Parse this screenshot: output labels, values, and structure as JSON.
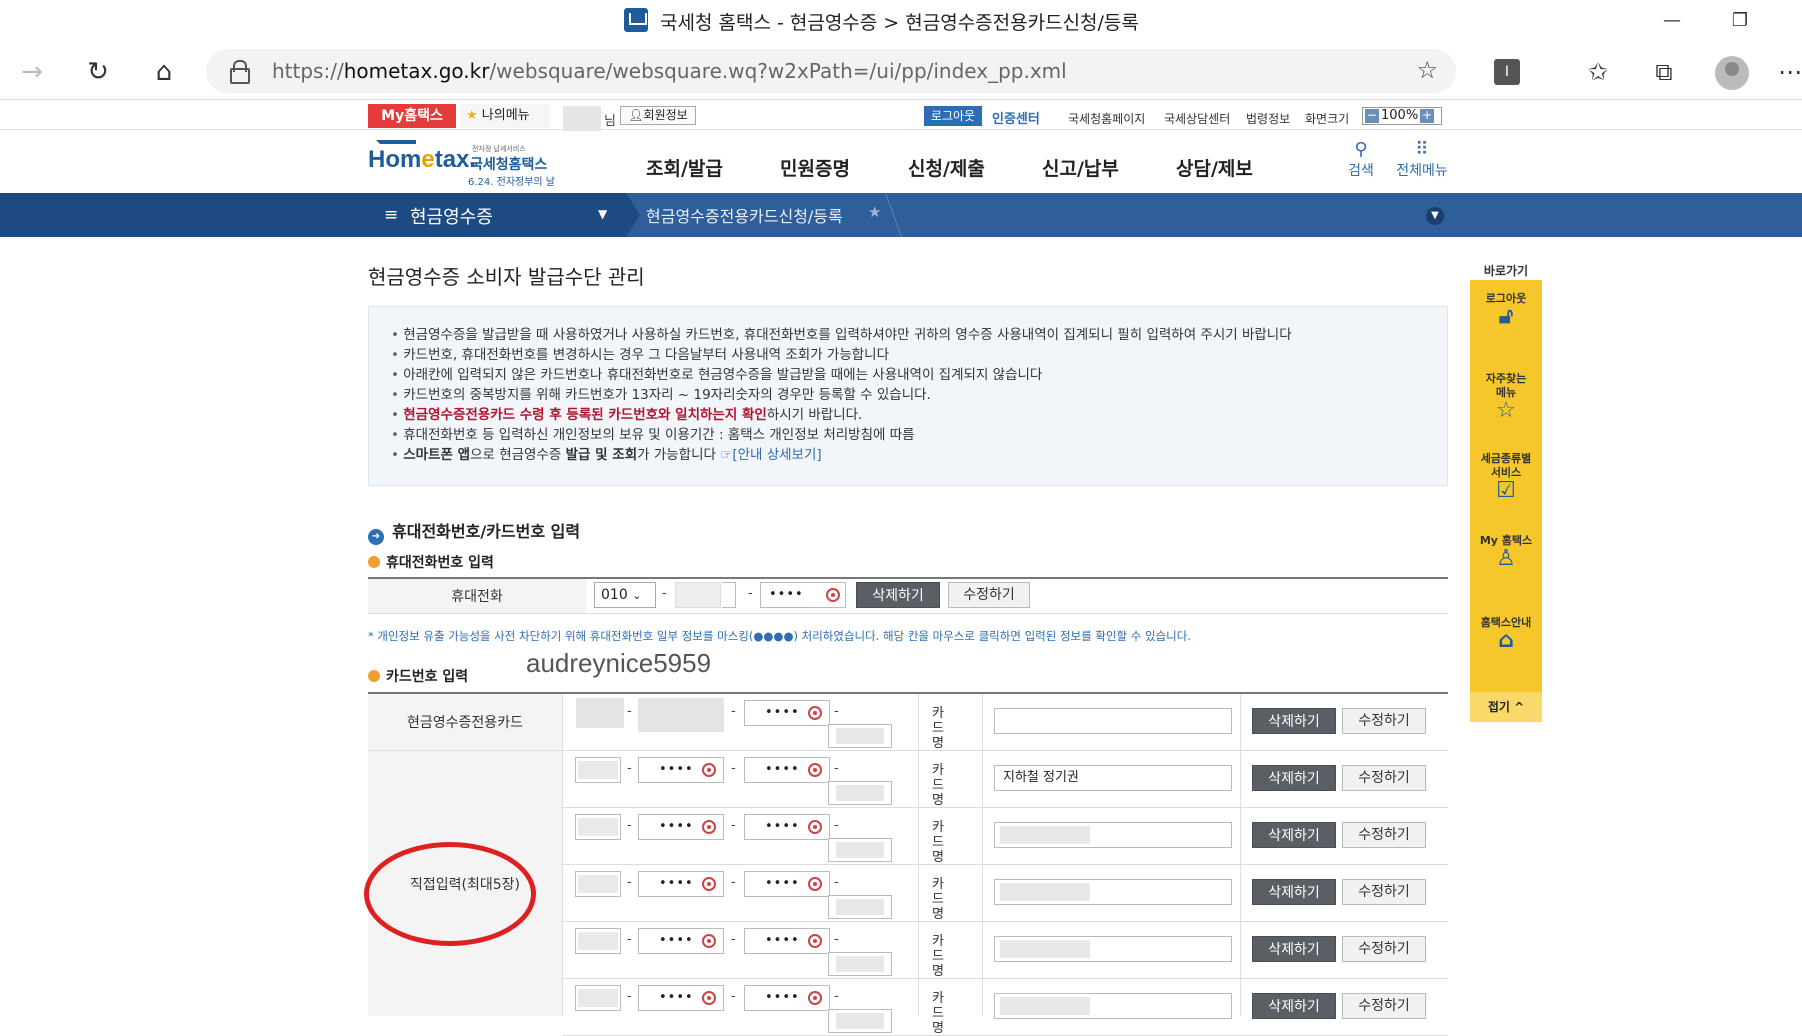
{
  "browser": {
    "title": "국세청 홈택스 - 현금영수증 > 현금영수증전용카드신청/등록",
    "url_prefix": "https://",
    "url_host": "hometax.go.kr",
    "url_path": "/websquare/websquare.wq?w2xPath=/ui/pp/index_pp.xml"
  },
  "util": {
    "my_home": "My홈택스",
    "my_menu": "나의메뉴",
    "nim": "님",
    "member_info": "회원정보",
    "logout": "로그아웃",
    "cert_center": "인증센터",
    "links": [
      "국세청홈페이지",
      "국세상담센터",
      "법령정보",
      "화면크기"
    ],
    "zoom": "100%"
  },
  "logo": {
    "home_a": "Hom",
    "home_e": "e",
    "home_b": "tax.",
    "kr": "국세청홈택스",
    "sub": "6.24. 전자정부의 날",
    "tiny": "전자정 납세서비스"
  },
  "gnb": [
    "조회/발급",
    "민원증명",
    "신청/제출",
    "신고/납부",
    "상담/제보"
  ],
  "header_icons": {
    "search": "검색",
    "all_menu": "전체메뉴"
  },
  "location": {
    "menu": "현금영수증",
    "current": "현금영수증전용카드신청/등록"
  },
  "page": {
    "title": "현금영수증 소비자 발급수단 관리"
  },
  "info": {
    "lines": [
      "현금영수증을 발급받을 때 사용하였거나 사용하실 카드번호, 휴대전화번호를 입력하셔야만 귀하의 영수증 사용내역이 집계되니 필히 입력하여 주시기 바랍니다",
      "카드번호, 휴대전화번호를 변경하시는 경우 그 다음날부터 사용내역 조회가 가능합니다",
      "아래칸에 입력되지 않은 카드번호나 휴대전화번호로 현금영수증을 발급받을 때에는 사용내역이 집계되지 않습니다",
      "카드번호의 중복방지를 위해 카드번호가 13자리 ~ 19자리숫자의 경우만 등록할 수 있습니다."
    ],
    "red_text": "현금영수증전용카드 수령 후 등록된 카드번호와 일치하는지 확인",
    "red_tail": "하시기 바랍니다.",
    "privacy": "휴대전화번호 등 입력하신 개인정보의 보유 및 이용기간 : 홈택스 개인정보 처리방침에 따름",
    "app_a": "스마트폰 앱",
    "app_b": "으로 현금영수증 ",
    "app_c": "발급 및 조회",
    "app_d": "가 가능합니다 ",
    "app_link": "☞[안내 상세보기]"
  },
  "section": {
    "title": "휴대전화번호/카드번호 입력"
  },
  "phone": {
    "subtitle": "휴대전화번호 입력",
    "label": "휴대전화",
    "prefix": "010",
    "masked": "••••",
    "delete": "삭제하기",
    "edit": "수정하기",
    "notice": "* 개인정보 유출 가능성을 사전 차단하기 위해 휴대전화번호 일부 정보를 마스킹(●●●●) 처리하였습니다. 해당 칸을 마우스로 클릭하면 입력된 정보를 확인할 수 있습니다."
  },
  "watermark": "audreynice5959",
  "card": {
    "subtitle": "카드번호 입력",
    "label_dedicated": "현금영수증전용카드",
    "label_direct": "직접입력(최대5장)",
    "card_name_label": "카드명",
    "masked": "••••",
    "delete": "삭제하기",
    "edit": "수정하기",
    "rows": [
      {
        "name": ""
      },
      {
        "name": "지하철 정기권"
      },
      {
        "name": ""
      },
      {
        "name": ""
      },
      {
        "name": ""
      },
      {
        "name": ""
      }
    ]
  },
  "quick": {
    "title": "바로가기",
    "items": [
      "로그아웃",
      "자주찾는 메뉴",
      "세금종류별 서비스",
      "My 홈택스",
      "홈택스안내"
    ],
    "fold": "접기 ^"
  },
  "colors": {
    "primary": "#1f5c9b",
    "locbar": "#2e5f9a",
    "red": "#e02020",
    "quick": "#f6c72b"
  }
}
